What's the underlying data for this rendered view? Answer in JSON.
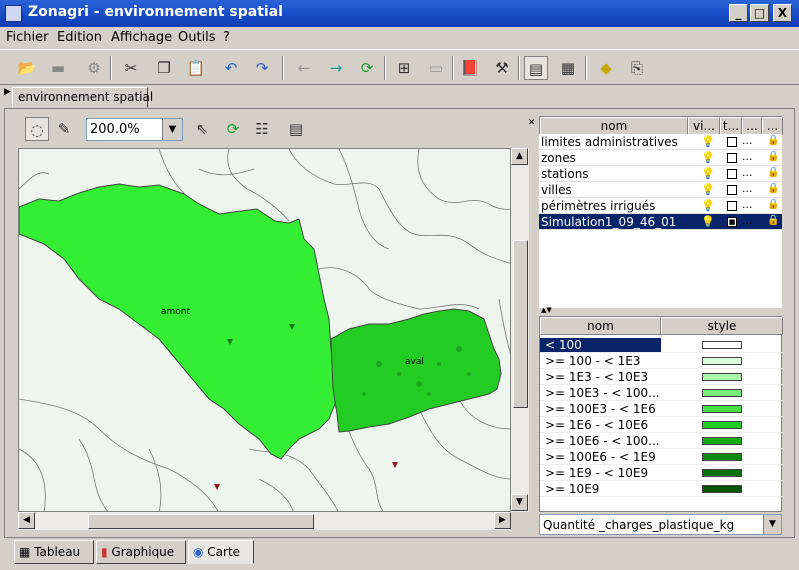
{
  "window": {
    "title": "Zonagri - environnement spatial",
    "min": "_",
    "max": "□",
    "close": "X"
  },
  "menu": [
    "Fichier",
    "Edition",
    "Affichage",
    "Outils",
    "?"
  ],
  "toolbar": {
    "icons": [
      "open-icon",
      "save-icon",
      "print-icon",
      "cut-icon",
      "copy-icon",
      "paste-icon",
      "undo-icon",
      "redo-icon",
      "back-arrow-icon",
      "forward-arrow-icon",
      "refresh-icon",
      "add-window-icon",
      "remove-window-icon",
      "book-icon",
      "settings-icon",
      "table-view-icon",
      "grid-view-icon",
      "warning-icon",
      "export-icon"
    ]
  },
  "tab": {
    "label": "environnement spatial"
  },
  "map_toolbar": {
    "zoom": "200.0%"
  },
  "map": {
    "labels": {
      "amont": "amont",
      "aval": "aval"
    },
    "colors": {
      "amont": "#33ee33",
      "aval": "#22cc22",
      "background": "#eef5ee",
      "border": "#444444"
    }
  },
  "layers": {
    "headers": [
      "nom",
      "vi...",
      "t...",
      "...",
      "..."
    ],
    "rows": [
      {
        "name": "limites administratives",
        "more": "..."
      },
      {
        "name": "zones",
        "more": "..."
      },
      {
        "name": "stations",
        "more": "..."
      },
      {
        "name": "villes",
        "more": "..."
      },
      {
        "name": "périmètres irrigués",
        "more": "..."
      },
      {
        "name": "Simulation1_09_46_01",
        "more": "...",
        "selected": true
      }
    ]
  },
  "styles": {
    "headers": [
      "nom",
      "style"
    ],
    "rows": [
      {
        "name": "< 100",
        "color": "#ffffff",
        "selected": true
      },
      {
        "name": ">= 100 - < 1E3",
        "color": "#ddffdd"
      },
      {
        "name": ">= 1E3 - < 10E3",
        "color": "#aaf5aa"
      },
      {
        "name": ">= 10E3 - < 100...",
        "color": "#77ee77"
      },
      {
        "name": ">= 100E3 - < 1E6",
        "color": "#44dd44"
      },
      {
        "name": ">= 1E6 - < 10E6",
        "color": "#22cc22"
      },
      {
        "name": ">= 10E6 - < 100...",
        "color": "#11aa11"
      },
      {
        "name": ">= 100E6 - < 1E9",
        "color": "#0a8a0a"
      },
      {
        "name": ">= 1E9 - < 10E9",
        "color": "#077007"
      },
      {
        "name": ">= 10E9",
        "color": "#055505"
      }
    ]
  },
  "quantity": {
    "value": "Quantité _charges_plastique_kg"
  },
  "bottom_tabs": [
    "Tableau",
    "Graphique",
    "Carte"
  ]
}
